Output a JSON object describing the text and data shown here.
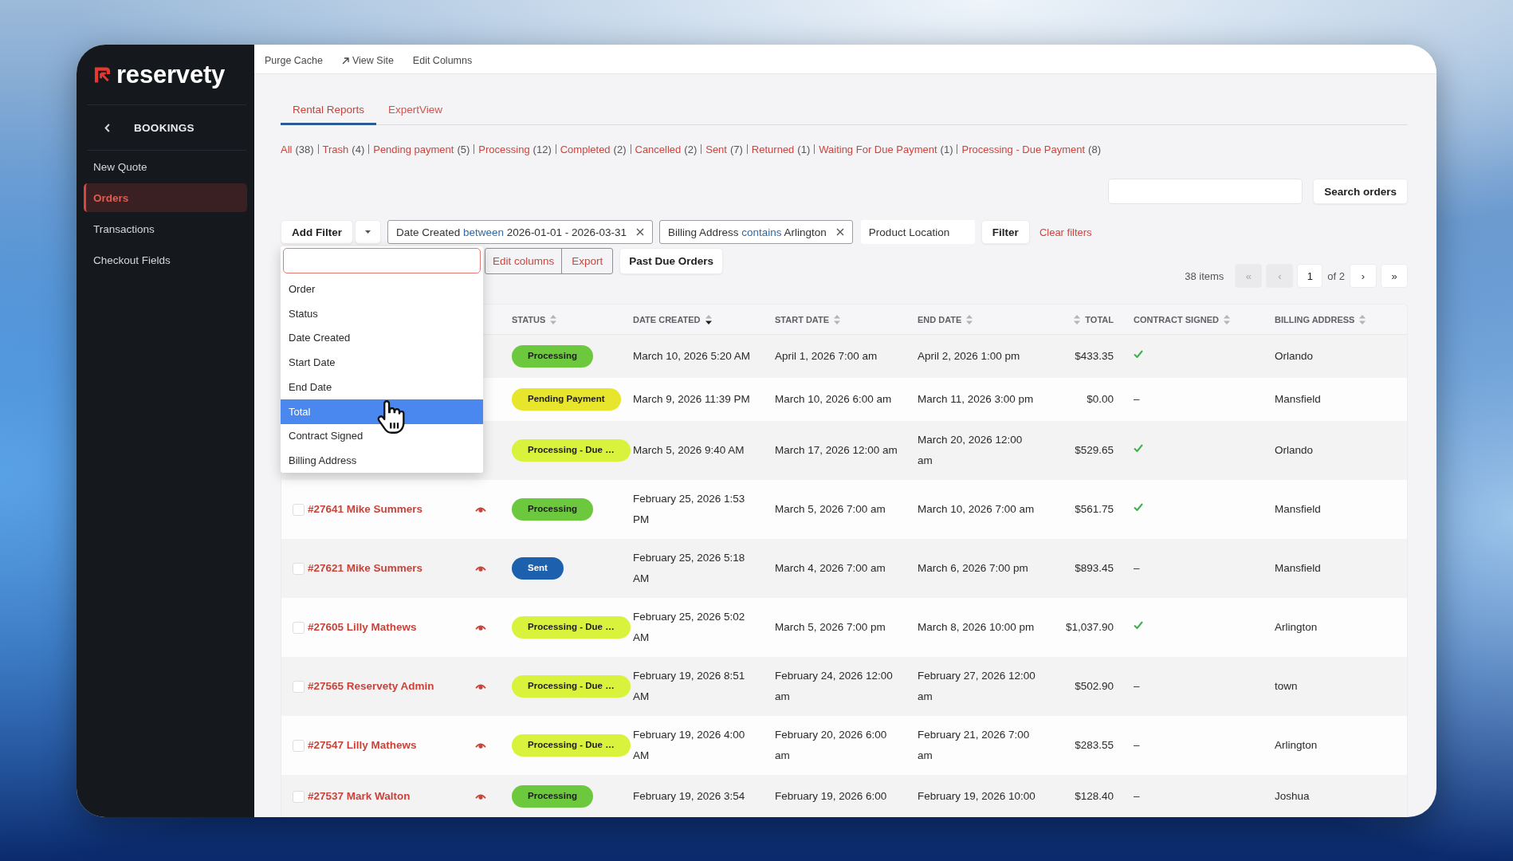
{
  "sidebar": {
    "brand": "reservety",
    "section": "BOOKINGS",
    "items": [
      {
        "label": "New Quote",
        "selected": false
      },
      {
        "label": "Orders",
        "selected": true
      },
      {
        "label": "Transactions",
        "selected": false
      },
      {
        "label": "Checkout Fields",
        "selected": false
      }
    ]
  },
  "top_bar": {
    "links": [
      {
        "label": "Purge Cache",
        "external": false
      },
      {
        "label": "View Site",
        "external": true
      },
      {
        "label": "Edit Columns",
        "external": false
      }
    ]
  },
  "tabs": [
    {
      "label": "Rental Reports",
      "selected": true
    },
    {
      "label": "ExpertView",
      "selected": false
    }
  ],
  "status_filters": [
    {
      "label": "All",
      "count": "(38)"
    },
    {
      "label": "Trash",
      "count": "(4)"
    },
    {
      "label": "Pending payment",
      "count": "(5)"
    },
    {
      "label": "Processing",
      "count": "(12)"
    },
    {
      "label": "Completed",
      "count": "(2)"
    },
    {
      "label": "Cancelled",
      "count": "(2)"
    },
    {
      "label": "Sent",
      "count": "(7)"
    },
    {
      "label": "Returned",
      "count": "(1)"
    },
    {
      "label": "Waiting For Due Payment",
      "count": "(1)"
    },
    {
      "label": "Processing - Due Payment",
      "count": "(8)"
    }
  ],
  "search": {
    "button": "Search orders"
  },
  "filter_bar": {
    "add_filter": "Add Filter",
    "chips": [
      {
        "field": "Date Created",
        "operator": "between",
        "value": "2026-01-01 - 2026-03-31"
      },
      {
        "field": "Billing Address",
        "operator": "contains",
        "value": "Arlington"
      }
    ],
    "location": "Product Location",
    "filter_button": "Filter",
    "clear_link": "Clear filters"
  },
  "filter_menu": {
    "items": [
      {
        "label": "Order",
        "selected": false
      },
      {
        "label": "Status",
        "selected": false
      },
      {
        "label": "Date Created",
        "selected": false
      },
      {
        "label": "Start Date",
        "selected": false
      },
      {
        "label": "End Date",
        "selected": false
      },
      {
        "label": "Total",
        "selected": true
      },
      {
        "label": "Contract Signed",
        "selected": false
      },
      {
        "label": "Billing Address",
        "selected": false
      }
    ]
  },
  "actions": {
    "edit_columns": "Edit columns",
    "export": "Export",
    "past_due": "Past Due Orders"
  },
  "pagination": {
    "count": "38 items",
    "first": {
      "label": "«",
      "disabled": true
    },
    "prev": {
      "label": "‹",
      "disabled": true
    },
    "page": "1",
    "of": "of 2",
    "next": {
      "label": "›",
      "disabled": false
    },
    "last": {
      "label": "»",
      "disabled": false
    }
  },
  "table": {
    "columns": [
      {
        "label": "STATUS",
        "kind": "status",
        "sorted_descending": false
      },
      {
        "label": "DATE CREATED",
        "kind": "date",
        "sorted_descending": true
      },
      {
        "label": "START DATE",
        "kind": "date",
        "sorted_descending": false
      },
      {
        "label": "END DATE",
        "kind": "date",
        "sorted_descending": false
      },
      {
        "label": "TOTAL",
        "kind": "money",
        "sorted_descending": false
      },
      {
        "label": "CONTRACT SIGNED",
        "kind": "check",
        "sorted_descending": false
      },
      {
        "label": "BILLING ADDRESS",
        "kind": "text",
        "sorted_descending": false
      }
    ],
    "rows": [
      {
        "status": {
          "label": "Processing",
          "color": "#6cc83d"
        },
        "created": "March 10, 2026 5:20 AM",
        "start": "April 1, 2026 7:00 am",
        "end": "April 2, 2026 1:00 pm",
        "total": "$433.35",
        "contract_signed": true,
        "billing": "Orlando"
      },
      {
        "status": {
          "label": "Pending Payment",
          "color": "#e8e62c"
        },
        "created": "March 9, 2026 11:39 PM",
        "start": "March 10, 2026 6:00 am",
        "end": "March 11, 2026 3:00 pm",
        "total": "$0.00",
        "contract_signed": false,
        "contract_note": "–",
        "billing": "Mansfield"
      },
      {
        "status": {
          "label": "Processing - Due …",
          "color": "#d9f23b"
        },
        "created": "March 5, 2026 9:40 AM",
        "start": "March 17, 2026 12:00 am",
        "end": "March 20, 2026 12:00 am",
        "total": "$529.65",
        "contract_signed": true,
        "billing": "Orlando"
      },
      {
        "checked": false,
        "order": "#27641 Mike Summers",
        "status": {
          "label": "Processing",
          "color": "#6cc83d"
        },
        "created": "February 25, 2026 1:53 PM",
        "start": "March 5, 2026 7:00 am",
        "end": "March 10, 2026 7:00 am",
        "total": "$561.75",
        "contract_signed": true,
        "billing": "Mansfield"
      },
      {
        "checked": false,
        "order": "#27621 Mike Summers",
        "status": {
          "label": "Sent",
          "color": "#1d60ae"
        },
        "created": "February 25, 2026 5:18 AM",
        "start": "March 4, 2026 7:00 am",
        "end": "March 6, 2026 7:00 pm",
        "total": "$893.45",
        "contract_signed": false,
        "contract_note": "–",
        "billing": "Mansfield"
      },
      {
        "checked": false,
        "order": "#27605 Lilly Mathews",
        "status": {
          "label": "Processing - Due …",
          "color": "#d9f23b"
        },
        "created": "February 25, 2026 5:02 AM",
        "start": "March 5, 2026 7:00 pm",
        "end": "March 8, 2026 10:00 pm",
        "total": "$1,037.90",
        "contract_signed": true,
        "billing": "Arlington"
      },
      {
        "checked": false,
        "order": "#27565 Reservety Admin",
        "status": {
          "label": "Processing - Due …",
          "color": "#d9f23b"
        },
        "created": "February 19, 2026 8:51 AM",
        "start": "February 24, 2026 12:00 am",
        "end": "February 27, 2026 12:00 am",
        "total": "$502.90",
        "contract_signed": false,
        "contract_note": "–",
        "billing": "town"
      },
      {
        "checked": false,
        "order": "#27547 Lilly Mathews",
        "status": {
          "label": "Processing - Due …",
          "color": "#d9f23b"
        },
        "created": "February 19, 2026 4:00 AM",
        "start": "February 20, 2026 6:00 am",
        "end": "February 21, 2026 7:00 am",
        "total": "$283.55",
        "contract_signed": false,
        "contract_note": "–",
        "billing": "Arlington"
      },
      {
        "checked": false,
        "order": "#27537 Mark Walton",
        "status": {
          "label": "Processing",
          "color": "#6cc83d"
        },
        "created": "February 19, 2026 3:54",
        "start": "February 19, 2026 6:00",
        "end": "February 19, 2026 10:00",
        "total": "$128.40",
        "contract_signed": false,
        "contract_note": "–",
        "billing": "Joshua"
      }
    ]
  }
}
